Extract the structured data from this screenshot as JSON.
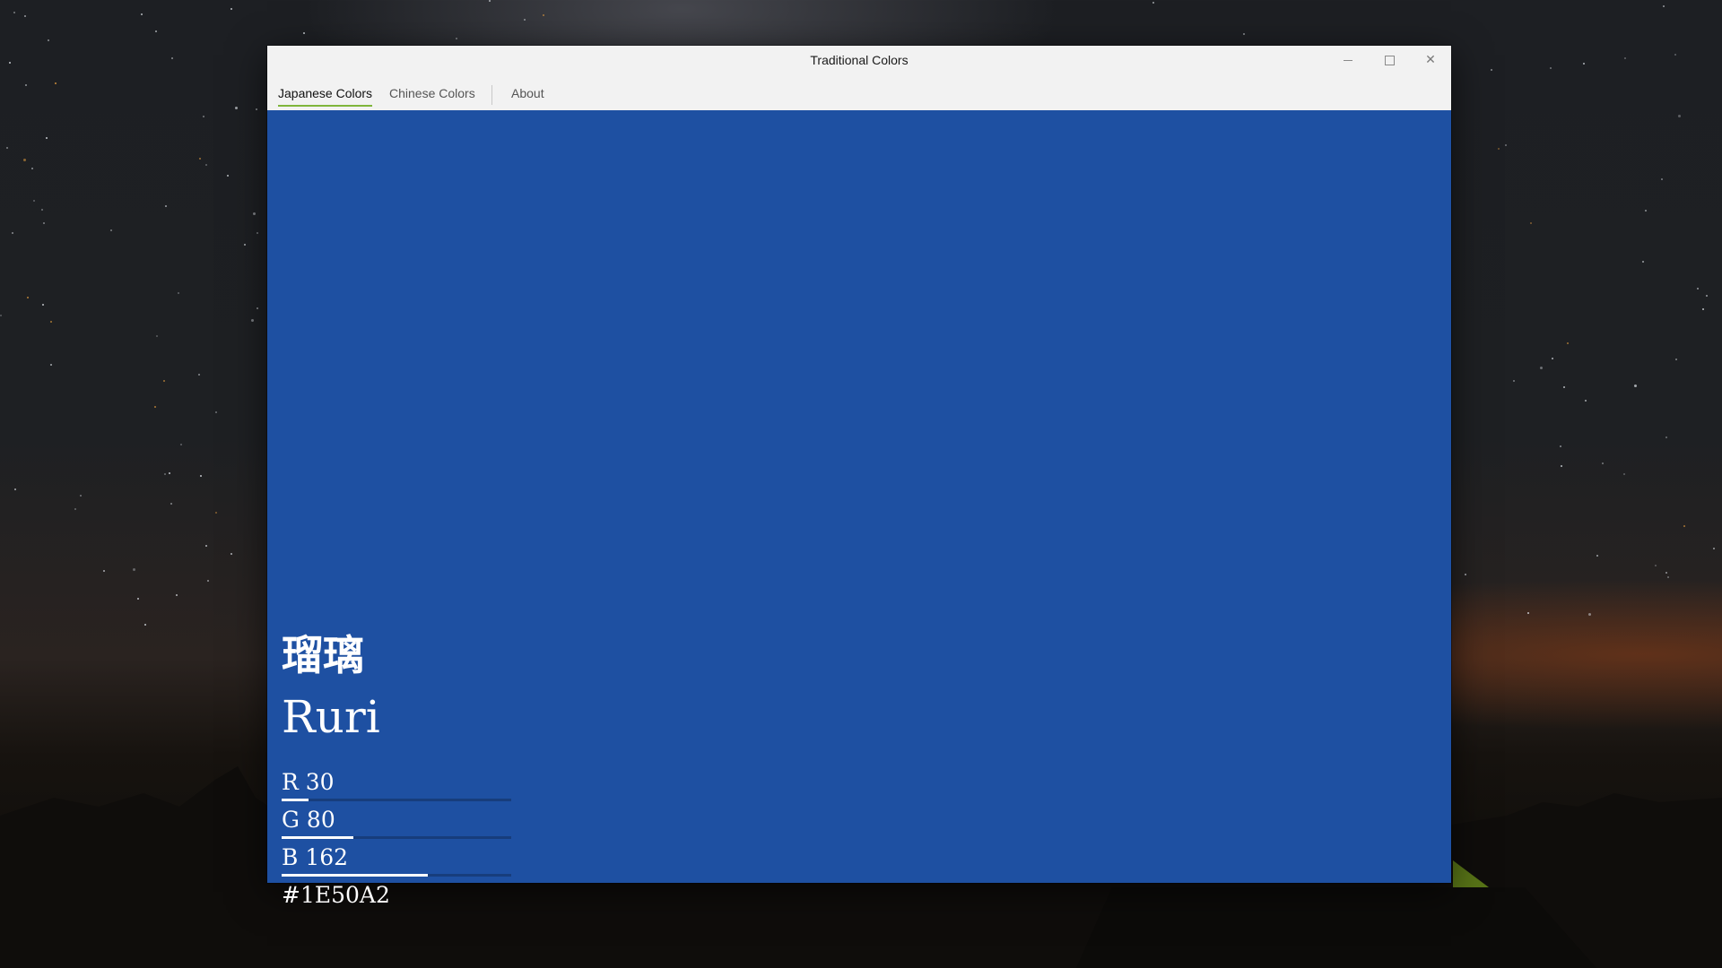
{
  "window": {
    "title": "Traditional Colors",
    "minimize_icon": "minimize-icon",
    "maximize_icon": "maximize-icon",
    "close_icon": "close-icon",
    "close_glyph": "✕"
  },
  "nav": {
    "tabs": [
      {
        "label": "Japanese Colors",
        "active": true
      },
      {
        "label": "Chinese Colors",
        "active": false
      },
      {
        "label": "About",
        "active": false
      }
    ],
    "accent_color": "#7fb53a"
  },
  "color": {
    "kanji": "瑠璃",
    "romaji": "Ruri",
    "r_label": "R 30",
    "g_label": "G 80",
    "b_label": "B 162",
    "r": 30,
    "g": 80,
    "b": 162,
    "hex": "#1E50A2",
    "background": "#1e50a2"
  }
}
